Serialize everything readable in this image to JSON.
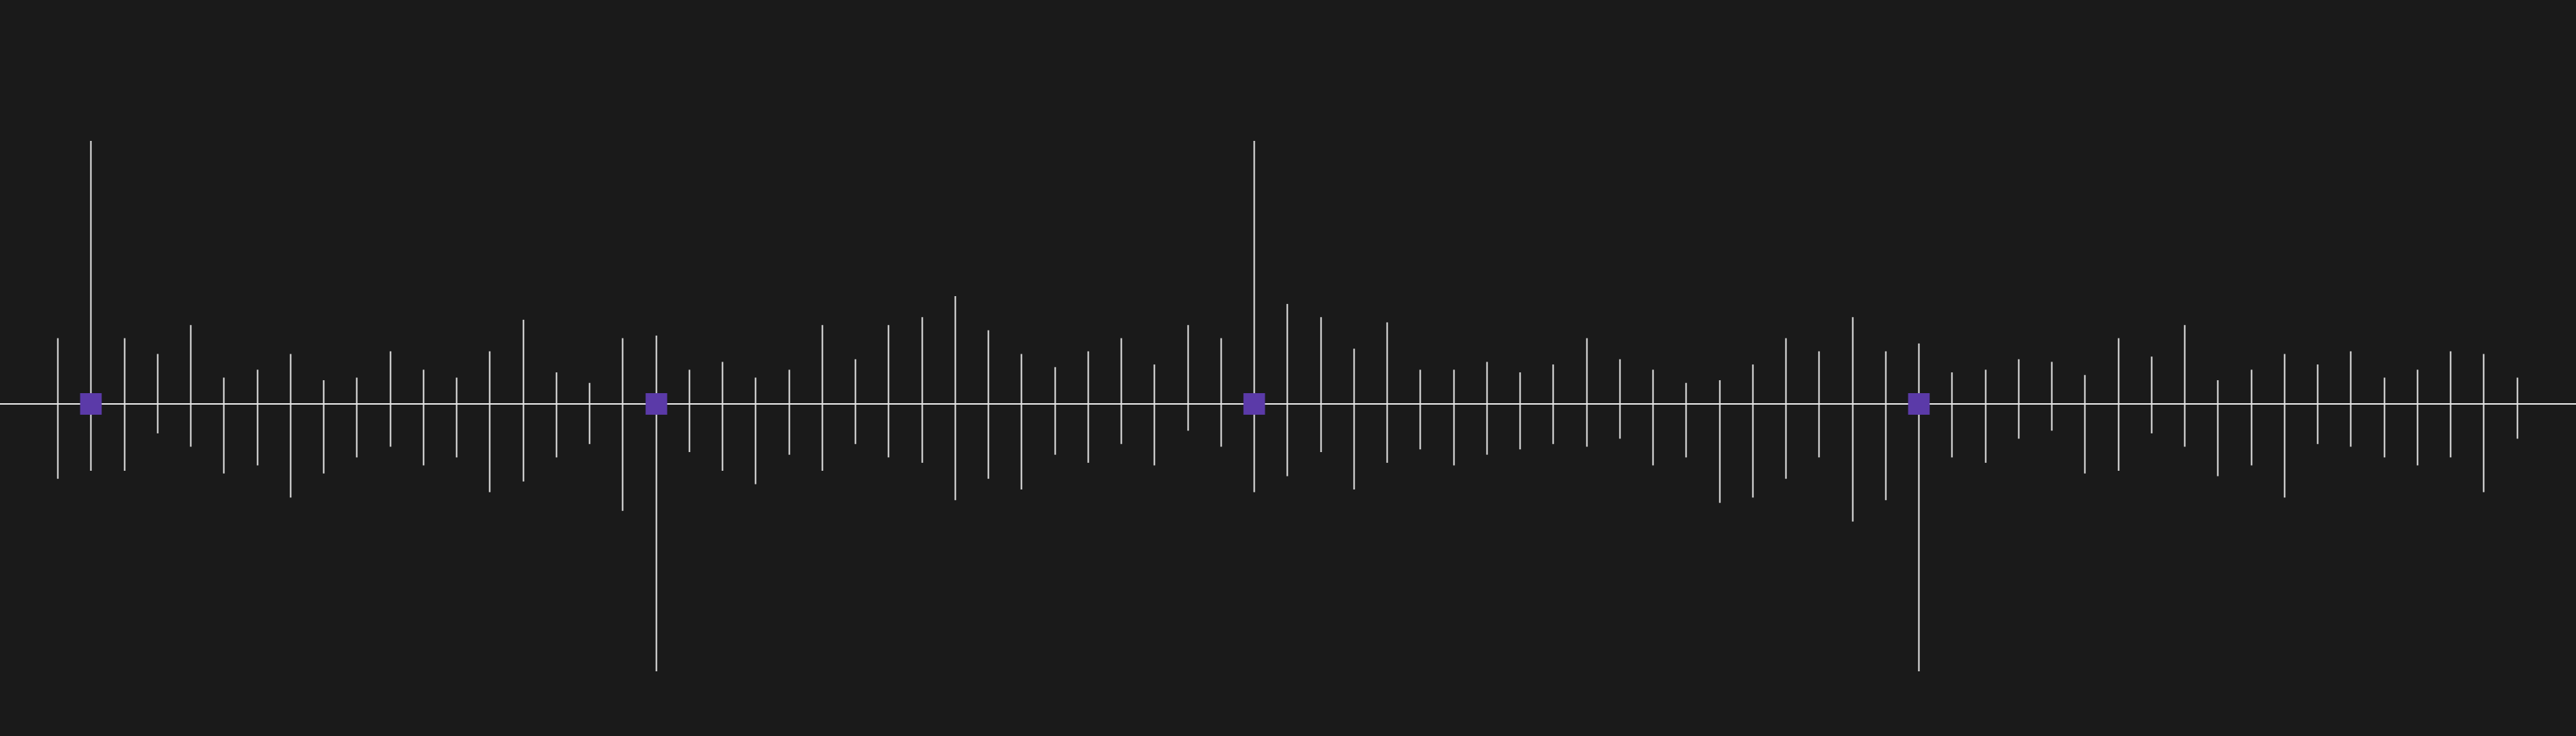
{
  "colors": {
    "background": "#1a1a1a",
    "line": "#e6e6e6",
    "marker": "#5b3aa8"
  },
  "timeline": {
    "lines": [
      {
        "up": 0.25,
        "down": 0.28
      },
      {
        "up": 1.0,
        "down": 0.25,
        "marker": true
      },
      {
        "up": 0.25,
        "down": 0.25
      },
      {
        "up": 0.19,
        "down": 0.11
      },
      {
        "up": 0.3,
        "down": 0.16
      },
      {
        "up": 0.1,
        "down": 0.26
      },
      {
        "up": 0.13,
        "down": 0.23
      },
      {
        "up": 0.19,
        "down": 0.35
      },
      {
        "up": 0.09,
        "down": 0.26
      },
      {
        "up": 0.1,
        "down": 0.2
      },
      {
        "up": 0.2,
        "down": 0.16
      },
      {
        "up": 0.13,
        "down": 0.23
      },
      {
        "up": 0.1,
        "down": 0.2
      },
      {
        "up": 0.2,
        "down": 0.33
      },
      {
        "up": 0.32,
        "down": 0.29
      },
      {
        "up": 0.12,
        "down": 0.2
      },
      {
        "up": 0.08,
        "down": 0.15
      },
      {
        "up": 0.25,
        "down": 0.4
      },
      {
        "up": 0.26,
        "down": 1.0,
        "marker": true
      },
      {
        "up": 0.13,
        "down": 0.18
      },
      {
        "up": 0.16,
        "down": 0.25
      },
      {
        "up": 0.1,
        "down": 0.3
      },
      {
        "up": 0.13,
        "down": 0.19
      },
      {
        "up": 0.3,
        "down": 0.25
      },
      {
        "up": 0.17,
        "down": 0.15
      },
      {
        "up": 0.3,
        "down": 0.2
      },
      {
        "up": 0.33,
        "down": 0.22
      },
      {
        "up": 0.41,
        "down": 0.36
      },
      {
        "up": 0.28,
        "down": 0.28
      },
      {
        "up": 0.19,
        "down": 0.32
      },
      {
        "up": 0.14,
        "down": 0.19
      },
      {
        "up": 0.2,
        "down": 0.22
      },
      {
        "up": 0.25,
        "down": 0.15
      },
      {
        "up": 0.15,
        "down": 0.23
      },
      {
        "up": 0.3,
        "down": 0.1
      },
      {
        "up": 0.25,
        "down": 0.16
      },
      {
        "up": 1.0,
        "down": 0.33,
        "marker": true
      },
      {
        "up": 0.38,
        "down": 0.27
      },
      {
        "up": 0.33,
        "down": 0.18
      },
      {
        "up": 0.21,
        "down": 0.32
      },
      {
        "up": 0.31,
        "down": 0.22
      },
      {
        "up": 0.13,
        "down": 0.17
      },
      {
        "up": 0.13,
        "down": 0.23
      },
      {
        "up": 0.16,
        "down": 0.19
      },
      {
        "up": 0.12,
        "down": 0.17
      },
      {
        "up": 0.15,
        "down": 0.15
      },
      {
        "up": 0.25,
        "down": 0.16
      },
      {
        "up": 0.17,
        "down": 0.13
      },
      {
        "up": 0.13,
        "down": 0.23
      },
      {
        "up": 0.08,
        "down": 0.2
      },
      {
        "up": 0.09,
        "down": 0.37
      },
      {
        "up": 0.15,
        "down": 0.35
      },
      {
        "up": 0.25,
        "down": 0.28
      },
      {
        "up": 0.2,
        "down": 0.2
      },
      {
        "up": 0.33,
        "down": 0.44
      },
      {
        "up": 0.2,
        "down": 0.36
      },
      {
        "up": 0.23,
        "down": 1.0,
        "marker": true
      },
      {
        "up": 0.12,
        "down": 0.2
      },
      {
        "up": 0.13,
        "down": 0.22
      },
      {
        "up": 0.17,
        "down": 0.13
      },
      {
        "up": 0.16,
        "down": 0.1
      },
      {
        "up": 0.11,
        "down": 0.26
      },
      {
        "up": 0.25,
        "down": 0.25
      },
      {
        "up": 0.18,
        "down": 0.11
      },
      {
        "up": 0.3,
        "down": 0.16
      },
      {
        "up": 0.09,
        "down": 0.27
      },
      {
        "up": 0.13,
        "down": 0.23
      },
      {
        "up": 0.19,
        "down": 0.35
      },
      {
        "up": 0.15,
        "down": 0.15
      },
      {
        "up": 0.2,
        "down": 0.16
      },
      {
        "up": 0.1,
        "down": 0.2
      },
      {
        "up": 0.13,
        "down": 0.23
      },
      {
        "up": 0.2,
        "down": 0.2
      },
      {
        "up": 0.19,
        "down": 0.33
      },
      {
        "up": 0.1,
        "down": 0.13
      }
    ]
  }
}
